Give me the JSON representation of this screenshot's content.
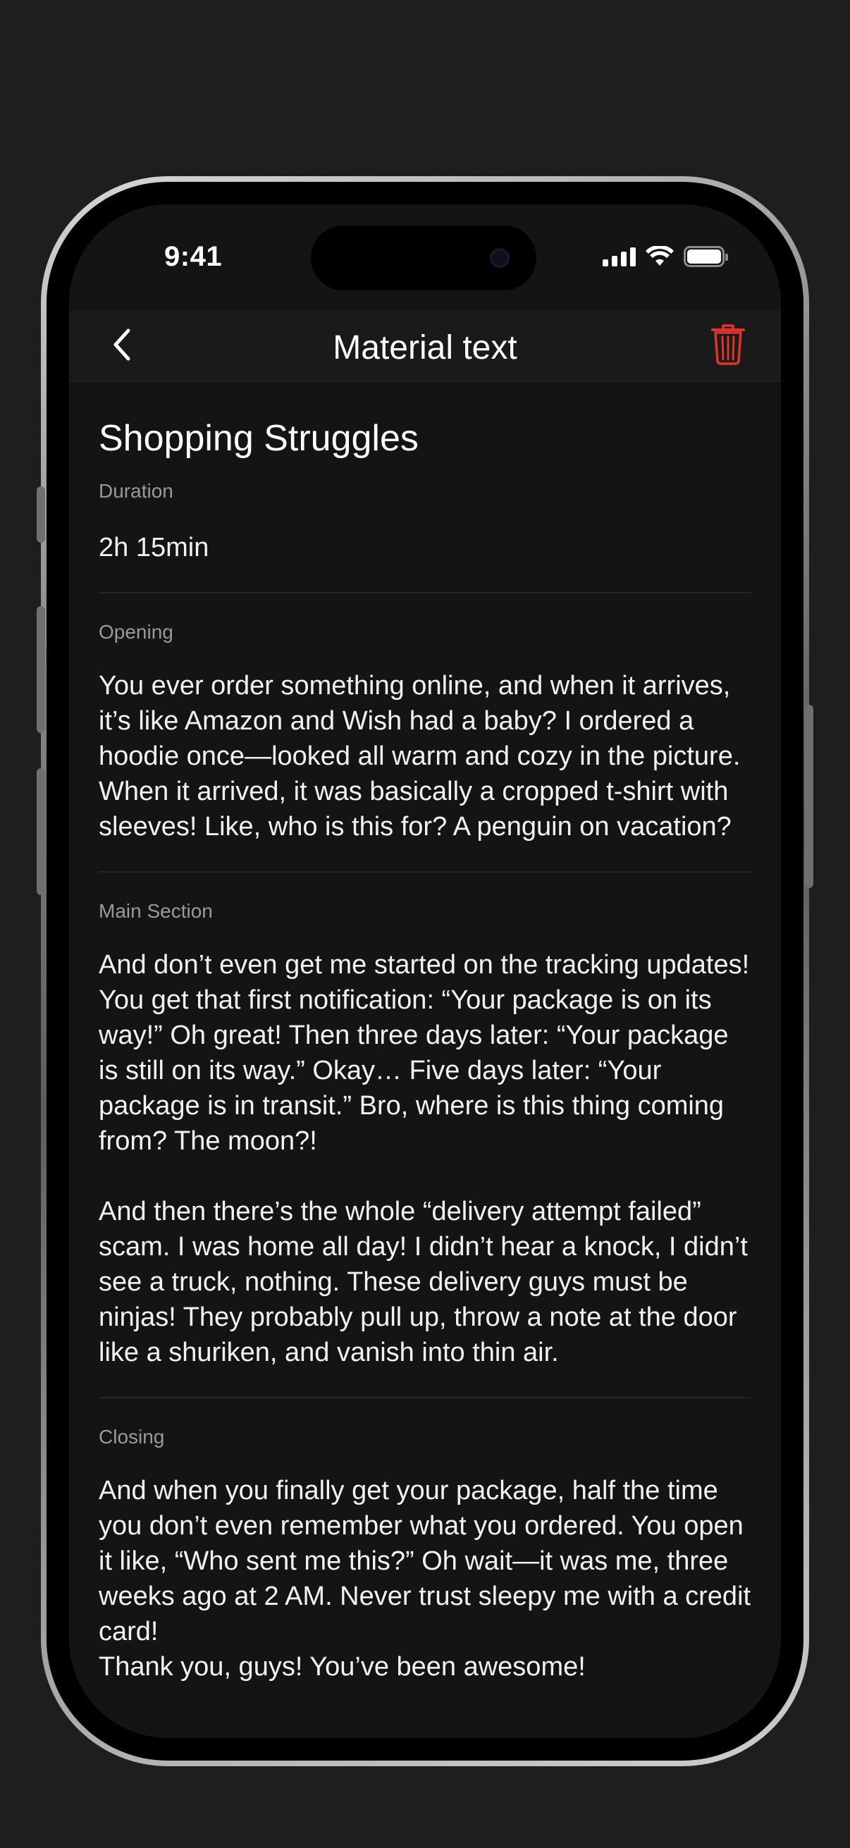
{
  "status_bar": {
    "time": "9:41"
  },
  "nav": {
    "title": "Material text",
    "back_icon": "chevron-left-icon",
    "delete_icon": "trash-icon",
    "delete_color": "#e0342b"
  },
  "document": {
    "title": "Shopping Struggles",
    "sections": [
      {
        "label": "Duration",
        "text": "2h 15min"
      },
      {
        "label": "Opening",
        "text": "You ever order something online, and when it arrives, it’s like Amazon and Wish had a baby? I ordered a hoodie once—looked all warm and cozy in the picture. When it arrived, it was basically a cropped t-shirt with sleeves! Like, who is this for? A penguin on vacation?"
      },
      {
        "label": "Main Section",
        "text": "And don’t even get me started on the tracking updates! You get that first notification: “Your package is on its way!” Oh great! Then three days later: “Your package is still on its way.” Okay… Five days later: “Your package is in transit.” Bro, where is this thing coming from? The moon?!\n\nAnd then there’s the whole “delivery attempt failed” scam. I was home all day! I didn’t hear a knock, I didn’t see a truck, nothing. These delivery guys must be ninjas! They probably pull up, throw a note at the door like a shuriken, and vanish into thin air."
      },
      {
        "label": "Closing",
        "text": "And when you finally get your package, half the time you don’t even remember what you ordered. You open it like, “Who sent me this?” Oh wait—it was me, three weeks ago at 2 AM. Never trust sleepy me with a credit card!\nThank you, guys! You’ve been awesome!"
      }
    ]
  }
}
